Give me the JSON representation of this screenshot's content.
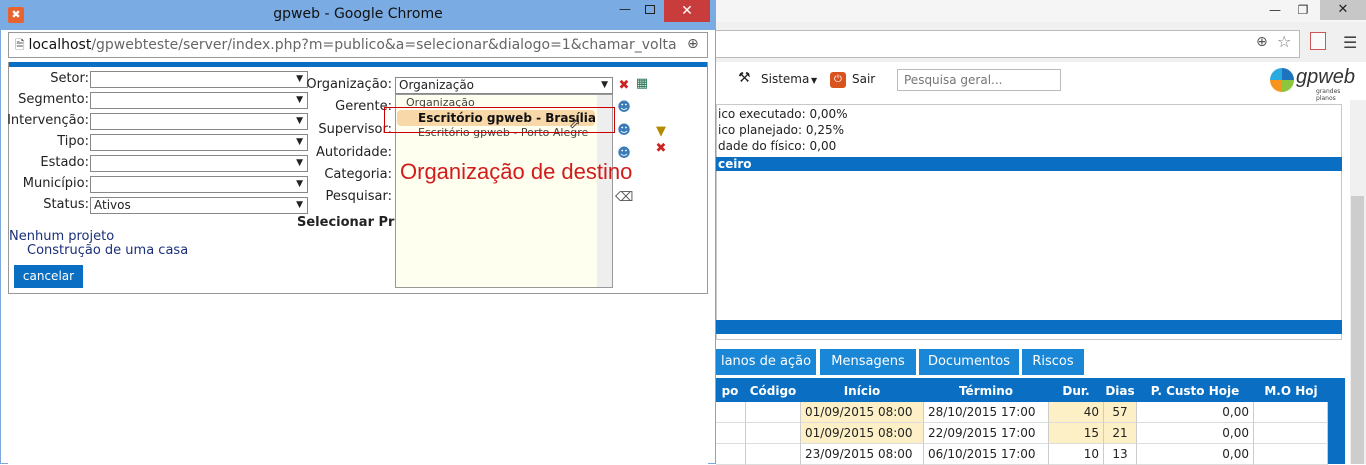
{
  "popup": {
    "title": "gpweb - Google Chrome",
    "url_host": "localhost",
    "url_path": "/gpwebteste/server/index.php?m=publico&a=selecionar&dialogo=1&chamar_volta",
    "labels": {
      "setor": "Setor:",
      "segmento": "Segmento:",
      "intervencao": "Intervenção:",
      "tipo": "Tipo:",
      "estado": "Estado:",
      "municipio": "Município:",
      "status": "Status:",
      "organizacao": "Organização:",
      "gerente": "Gerente:",
      "supervisor": "Supervisor:",
      "autoridade": "Autoridade:",
      "categoria": "Categoria:",
      "pesquisar": "Pesquisar:"
    },
    "status_value": "Ativos",
    "organizacao_value": "Organização",
    "section_heading": "Selecionar Pro",
    "no_project": "Nenhum projeto",
    "project_item": "Construção de uma casa",
    "cancel_label": "cancelar",
    "dropdown_options": [
      "Organização",
      "Escritório gpweb - Brasília",
      "Escritório gpweb - Porto Alegre"
    ],
    "annotation": "Organização de destino"
  },
  "main": {
    "toolbar": {
      "sistema": "Sistema",
      "sair": "Sair",
      "search_placeholder": "Pesquisa geral..."
    },
    "logo_text": "gpweb",
    "logo_sub": "grandes planos",
    "info_lines": [
      "ico executado: 0,00%",
      "ico planejado: 0,25%",
      "dade do físico: 0,00"
    ],
    "section_bar": "ceiro",
    "tabs": [
      "lanos de ação",
      "Mensagens",
      "Documentos",
      "Riscos"
    ],
    "table": {
      "headers": [
        "po",
        "Código",
        "Início",
        "Término",
        "Dur.",
        "Dias",
        "P. Custo Hoje",
        "M.O Hoj"
      ],
      "rows": [
        {
          "inicio": "01/09/2015 08:00",
          "termino": "28/10/2015 17:00",
          "dur": "40",
          "dias": "57",
          "custo": "0,00"
        },
        {
          "inicio": "01/09/2015 08:00",
          "termino": "22/09/2015 17:00",
          "dur": "15",
          "dias": "21",
          "custo": "0,00"
        },
        {
          "inicio": "23/09/2015 08:00",
          "termino": "06/10/2015 17:00",
          "dur": "10",
          "dias": "13",
          "custo": "0,00"
        }
      ]
    }
  }
}
